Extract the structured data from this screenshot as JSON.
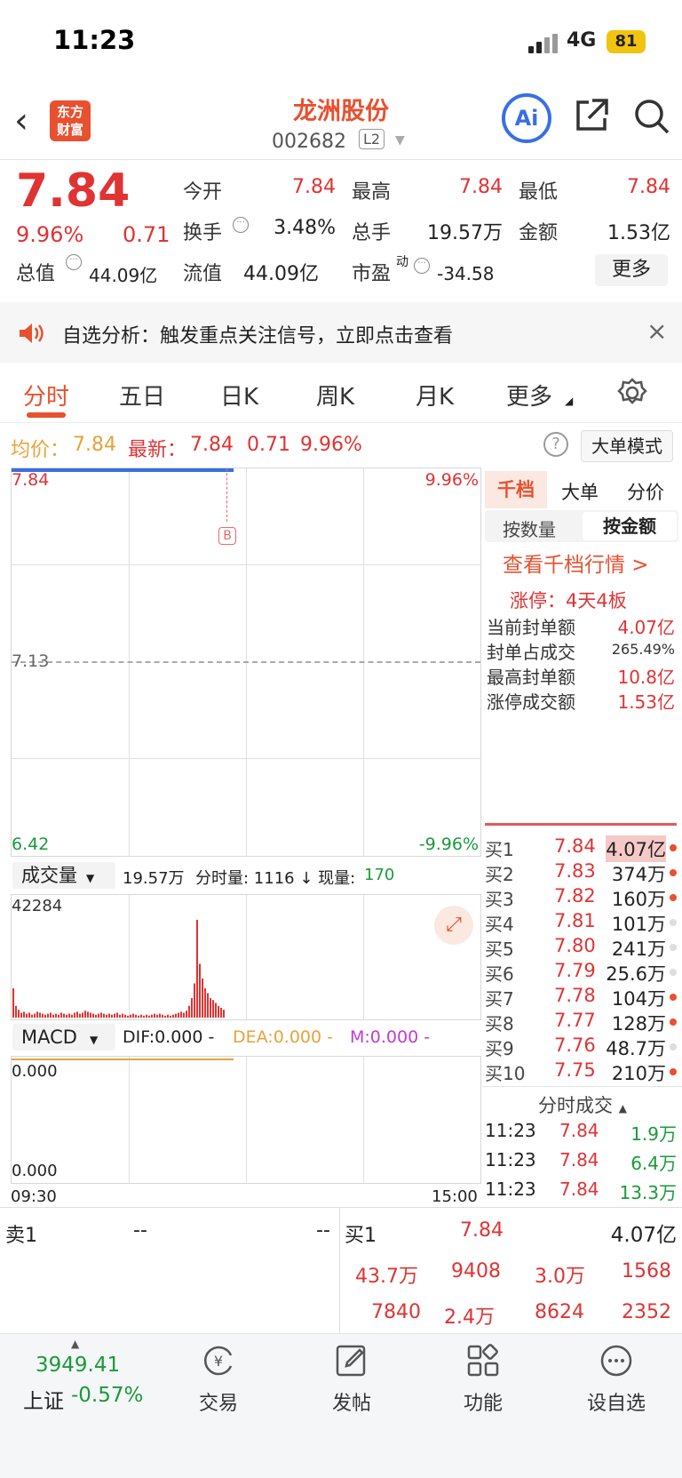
{
  "status": {
    "time": "11:23",
    "network": "4G",
    "battery": "81"
  },
  "header": {
    "logo_line1": "东方",
    "logo_line2": "财富",
    "stock_name": "龙洲股份",
    "stock_code": "002682",
    "level": "L2",
    "ai_label": "Ai"
  },
  "quote": {
    "price": "7.84",
    "pct": "9.96%",
    "change": "0.71",
    "open_label": "今开",
    "open": "7.84",
    "high_label": "最高",
    "high": "7.84",
    "low_label": "最低",
    "low": "7.84",
    "turnover_label": "换手",
    "turnover": "3.48%",
    "volume_label": "总手",
    "volume": "19.57万",
    "amount_label": "金额",
    "amount": "1.53亿",
    "mktcap_label": "总值",
    "mktcap": "44.09亿",
    "float_label": "流值",
    "float": "44.09亿",
    "pe_label": "市盈",
    "pe_sup": "动",
    "pe": "-34.58",
    "more": "更多"
  },
  "notice": {
    "text": "自选分析：触发重点关注信号，立即点击查看",
    "close": "×"
  },
  "tabs": [
    "分时",
    "五日",
    "日K",
    "周K",
    "月K",
    "更多"
  ],
  "priceline": {
    "avg_label": "均价：",
    "avg": "7.84",
    "last_label": "最新：",
    "last": "7.84",
    "chg": "0.71",
    "pct": "9.96%",
    "bigmode": "大单模式"
  },
  "chart": {
    "top_left": "7.84",
    "top_right": "9.96%",
    "mid": "7.13",
    "bottom_left": "6.42",
    "bottom_right": "-9.96%",
    "marker": "B",
    "start_time": "09:30",
    "end_time": "15:00"
  },
  "volume": {
    "selector": "成交量",
    "total": "19.57万",
    "detail_label": "分时量: 1116 ↓ 现量:",
    "detail_value": "170",
    "max": "42284",
    "bars": [
      0.3,
      0.12,
      0.08,
      0.05,
      0.06,
      0.04,
      0.05,
      0.03,
      0.04,
      0.06,
      0.05,
      0.04,
      0.03,
      0.04,
      0.05,
      0.03,
      0.04,
      0.03,
      0.05,
      0.04,
      0.03,
      0.04,
      0.03,
      0.05,
      0.06,
      0.04,
      0.05,
      0.07,
      0.06,
      0.05,
      0.04,
      0.03,
      0.04,
      0.05,
      0.04,
      0.03,
      0.04,
      0.03,
      0.04,
      0.05,
      0.03,
      0.04,
      0.03,
      0.02,
      0.03,
      0.04,
      0.03,
      0.02,
      0.03,
      0.02,
      0.03,
      0.02,
      0.03,
      0.04,
      0.03,
      0.04,
      0.03,
      0.02,
      0.03,
      0.02,
      0.03,
      0.04,
      0.05,
      0.06,
      0.05,
      0.07,
      0.12,
      0.2,
      0.35,
      1.0,
      0.55,
      0.4,
      0.3,
      0.25,
      0.2,
      0.18,
      0.15,
      0.12,
      0.1,
      0.08
    ]
  },
  "macd": {
    "selector": "MACD",
    "dif": "DIF:0.000 -",
    "dea": "DEA:0.000 -",
    "m": "M:0.000 -",
    "top": "0.000",
    "bottom": "0.000"
  },
  "panel": {
    "tabs": [
      "千档",
      "大单",
      "分价"
    ],
    "sub": [
      "按数量",
      "按金额"
    ],
    "link": "查看千档行情 >",
    "limit": "涨停：4天4板",
    "stats": [
      {
        "label": "当前封单额",
        "value": "4.07亿"
      },
      {
        "label": "封单占成交",
        "value": "265.49%"
      },
      {
        "label": "最高封单额",
        "value": "10.8亿"
      },
      {
        "label": "涨停成交额",
        "value": "1.53亿"
      }
    ],
    "bids": [
      {
        "n": "买1",
        "p": "7.84",
        "v": "4.07亿"
      },
      {
        "n": "买2",
        "p": "7.83",
        "v": "374万"
      },
      {
        "n": "买3",
        "p": "7.82",
        "v": "160万"
      },
      {
        "n": "买4",
        "p": "7.81",
        "v": "101万"
      },
      {
        "n": "买5",
        "p": "7.80",
        "v": "241万"
      },
      {
        "n": "买6",
        "p": "7.79",
        "v": "25.6万"
      },
      {
        "n": "买7",
        "p": "7.78",
        "v": "104万"
      },
      {
        "n": "买8",
        "p": "7.77",
        "v": "128万"
      },
      {
        "n": "买9",
        "p": "7.76",
        "v": "48.7万"
      },
      {
        "n": "买10",
        "p": "7.75",
        "v": "210万"
      }
    ],
    "trades_label": "分时成交",
    "trades": [
      {
        "t": "11:23",
        "p": "7.84",
        "v": "1.9万"
      },
      {
        "t": "11:23",
        "p": "7.84",
        "v": "6.4万"
      },
      {
        "t": "11:23",
        "p": "7.84",
        "v": "13.3万"
      }
    ]
  },
  "bottom": {
    "sell1": "卖1",
    "sell1_p": "--",
    "sell1_v": "--",
    "buy1": "买1",
    "buy1_p": "7.84",
    "buy1_v": "4.07亿",
    "row1": [
      "43.7万",
      "9408",
      "3.0万",
      "1568"
    ],
    "row2": [
      "7840",
      "2.4万",
      "8624",
      "2352"
    ]
  },
  "tabbar": {
    "index_value": "3949.41",
    "index_name": "上证",
    "index_pct": "-0.57%",
    "items": [
      "交易",
      "发帖",
      "功能",
      "设自选"
    ]
  }
}
